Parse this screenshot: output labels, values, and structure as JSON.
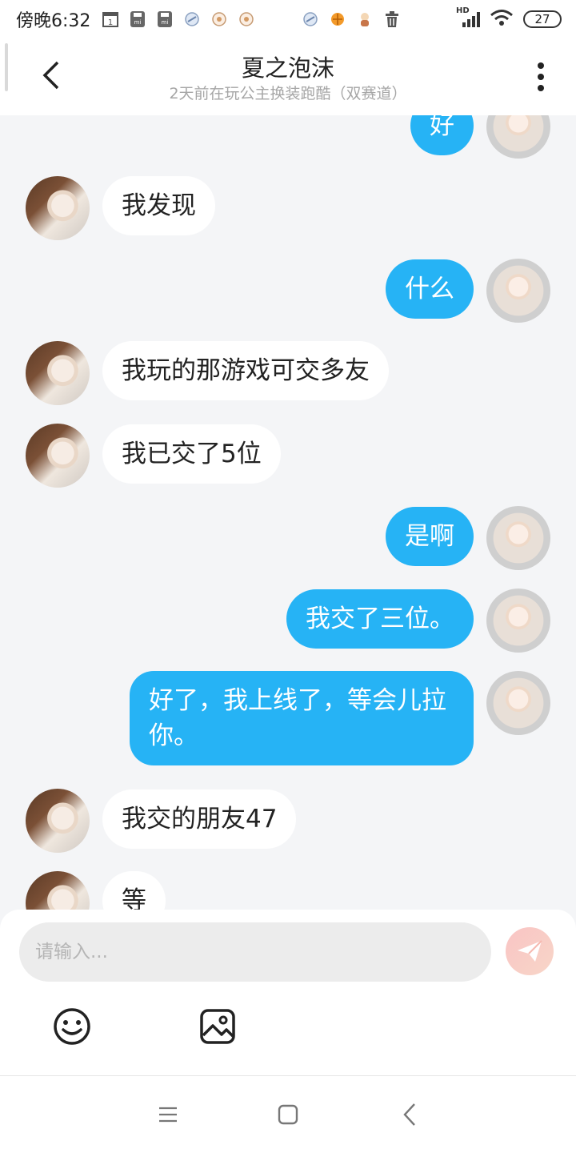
{
  "status_bar": {
    "time": "傍晚6:32",
    "notification_icons": [
      "calendar-icon",
      "mi-icon",
      "mi-icon",
      "app-icon",
      "app-icon",
      "app-icon",
      "app-icon",
      "app-icon",
      "app-icon",
      "trash-icon"
    ],
    "signal_label": "HD",
    "battery": "27"
  },
  "header": {
    "title": "夏之泡沫",
    "subtitle": "2天前在玩公主换装跑酷（双赛道）"
  },
  "messages": [
    {
      "side": "out",
      "text": "好"
    },
    {
      "side": "in",
      "text": "我发现"
    },
    {
      "side": "out",
      "text": "什么"
    },
    {
      "side": "in",
      "text": "我玩的那游戏可交多友"
    },
    {
      "side": "in",
      "text": "我已交了5位"
    },
    {
      "side": "out",
      "text": "是啊"
    },
    {
      "side": "out",
      "text": "我交了三位。"
    },
    {
      "side": "out",
      "text": "好了，我上线了，等会儿拉你。"
    },
    {
      "side": "in",
      "text": "我交的朋友47"
    },
    {
      "side": "in",
      "text": "等"
    }
  ],
  "input": {
    "placeholder": "请输入...",
    "value": ""
  },
  "colors": {
    "accent": "#26b3f5",
    "background": "#f4f5f7",
    "incoming_bubble": "#ffffff",
    "send_button": "#f9c4c4"
  },
  "nav": {
    "icons": [
      "menu-icon",
      "home-icon",
      "back-icon"
    ]
  }
}
